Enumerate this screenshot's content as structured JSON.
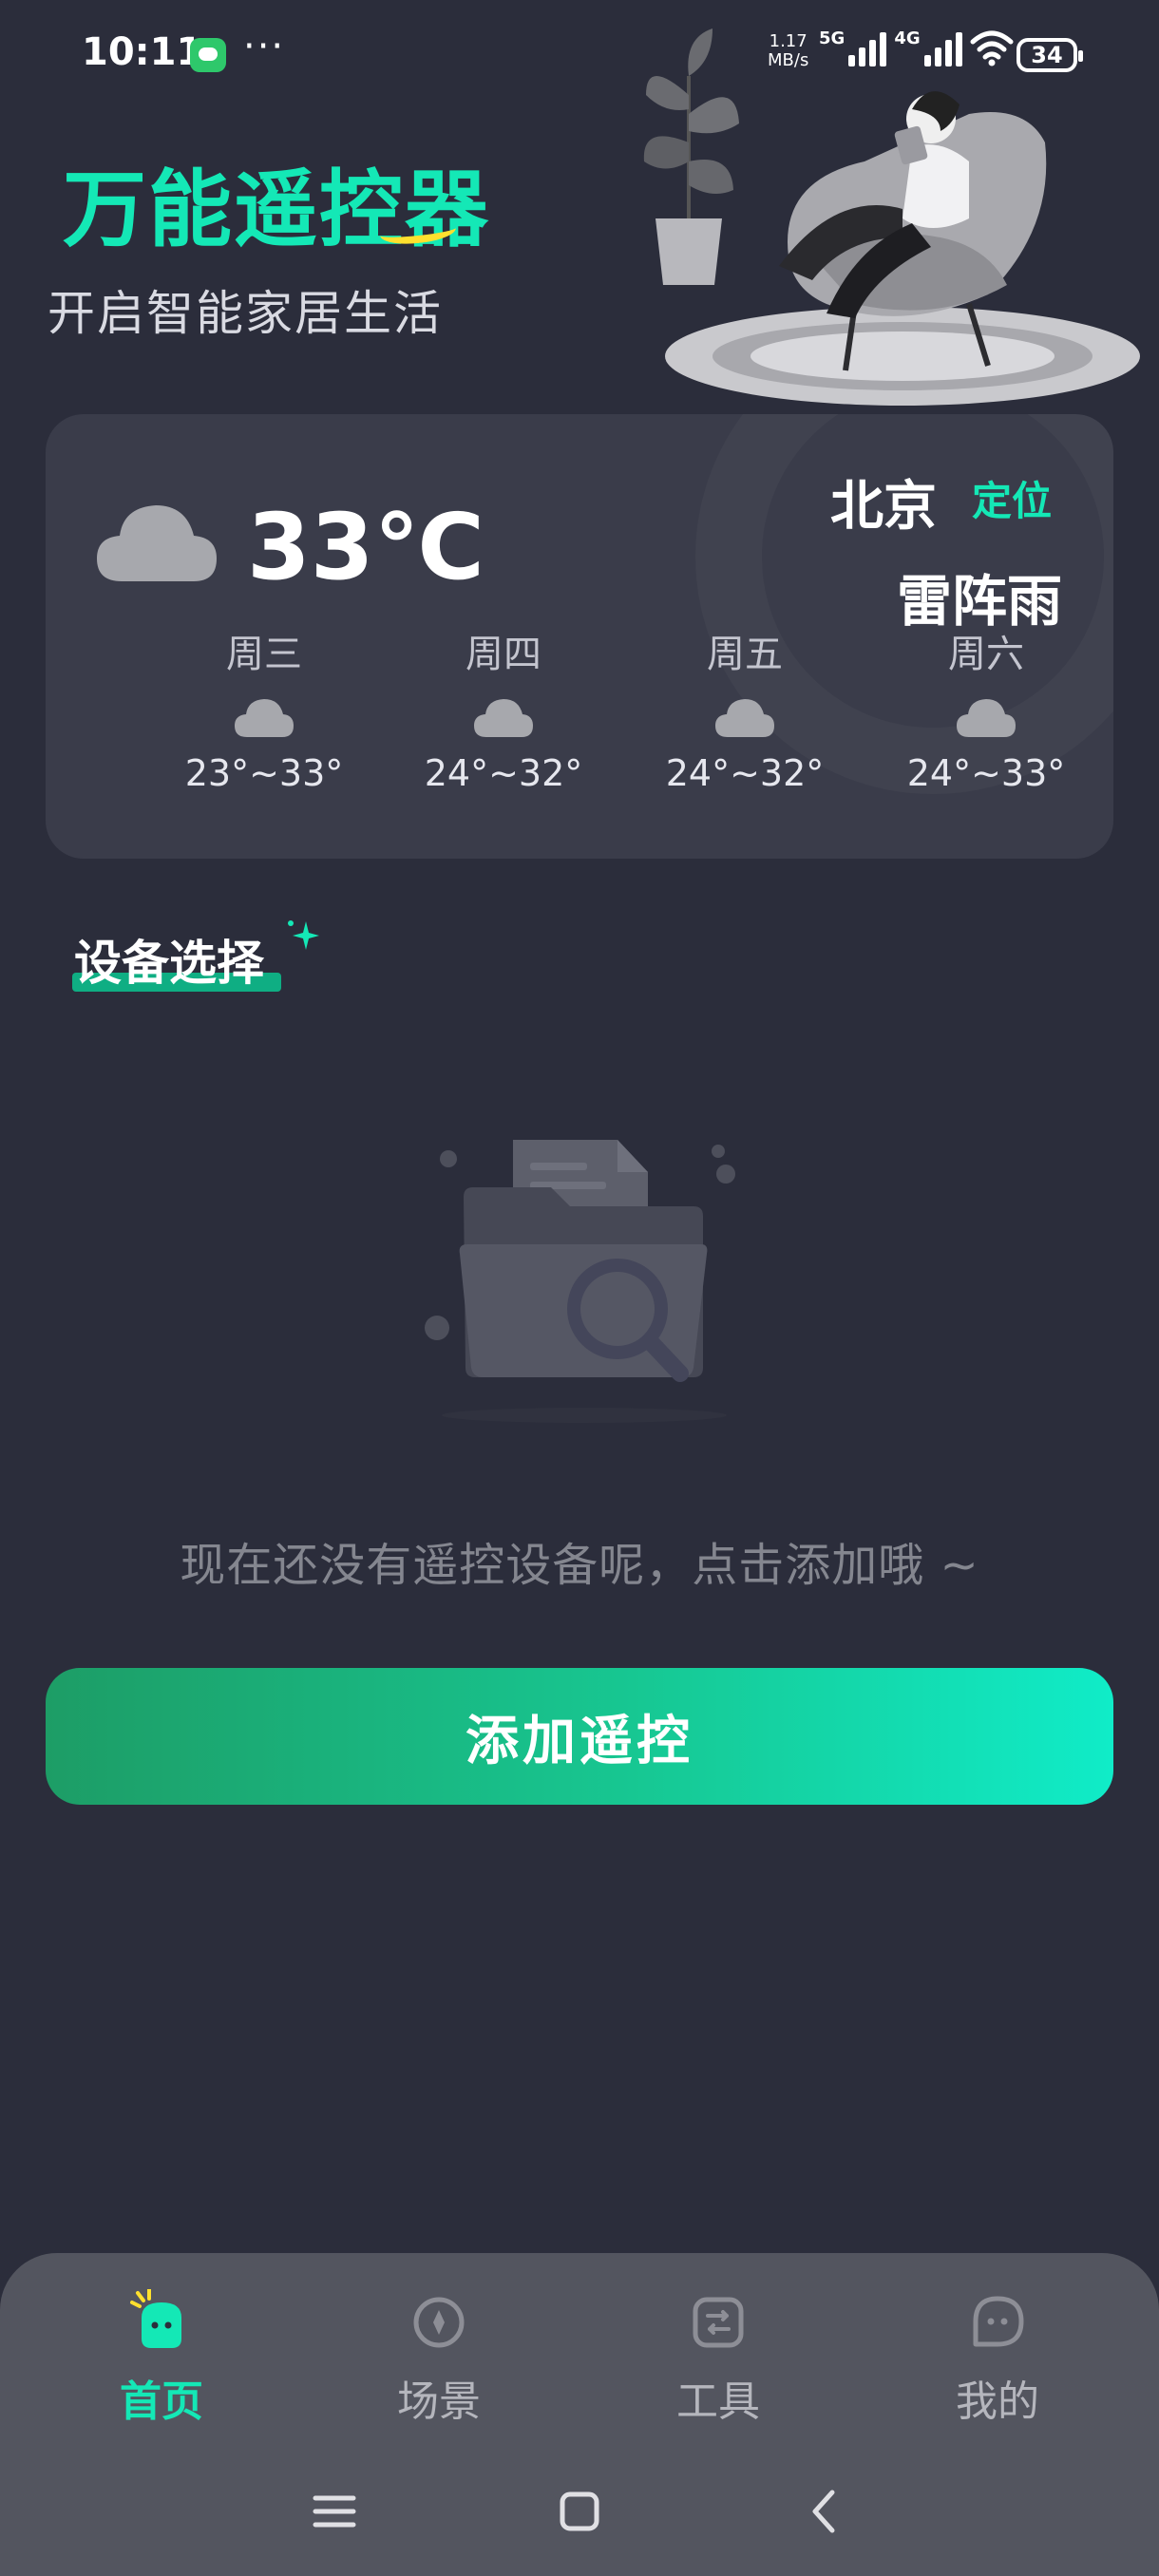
{
  "status_bar": {
    "time": "10:11",
    "more": "···",
    "net_speed_value": "1.17",
    "net_speed_unit": "MB/s",
    "net_5g": "5G",
    "net_4g": "4G",
    "battery": "34"
  },
  "header": {
    "title": "万能遥控器",
    "subtitle": "开启智能家居生活"
  },
  "weather": {
    "temperature": "33℃",
    "city": "北京",
    "locate_label": "定位",
    "condition": "雷阵雨",
    "forecast": [
      {
        "day": "周三",
        "range": "23°~33°",
        "icon": "cloud-icon"
      },
      {
        "day": "周四",
        "range": "24°~32°",
        "icon": "cloud-icon"
      },
      {
        "day": "周五",
        "range": "24°~32°",
        "icon": "cloud-icon"
      },
      {
        "day": "周六",
        "range": "24°~33°",
        "icon": "cloud-icon"
      }
    ]
  },
  "devices": {
    "section_title": "设备选择",
    "empty_message": "现在还没有遥控设备呢，点击添加哦 ~",
    "add_button_label": "添加遥控"
  },
  "bottom_nav": {
    "items": [
      {
        "label": "首页",
        "icon": "home-robot-icon",
        "active": true
      },
      {
        "label": "场景",
        "icon": "compass-icon",
        "active": false
      },
      {
        "label": "工具",
        "icon": "toolbox-icon",
        "active": false
      },
      {
        "label": "我的",
        "icon": "chat-bubble-icon",
        "active": false
      }
    ]
  },
  "colors": {
    "background": "#2b2d3b",
    "accent": "#14e8b6",
    "card": "#3a3c4a",
    "nav": "#53555f"
  }
}
